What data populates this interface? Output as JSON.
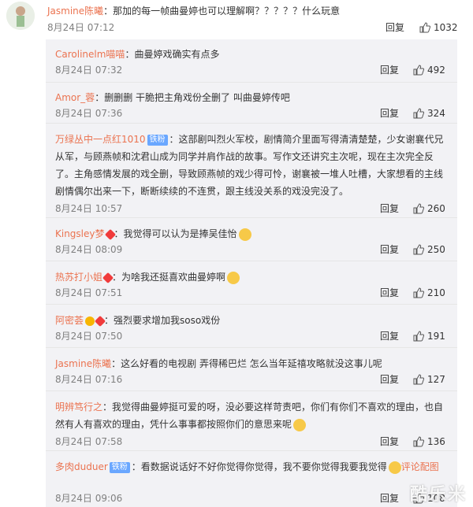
{
  "top": {
    "user": "Jasmine陈曦",
    "text": "：那加的每一帧曲曼婷也可以理解啊？？？？？什么玩意",
    "date": "8月24日 07:12",
    "reply": "回复",
    "likes": "1032"
  },
  "thread": [
    {
      "user": "Carolinelm喵喵",
      "text": "：曲曼婷戏确实有点多",
      "date": "8月24日 07:32",
      "reply": "回复",
      "likes": "492"
    },
    {
      "user": "Amor_蓉",
      "text": "：删删删 干脆把主角戏份全删了 叫曲曼婷传吧",
      "date": "8月24日 07:36",
      "reply": "回复",
      "likes": "324"
    },
    {
      "user": "万绿丛中一点红1010",
      "badge": "铁粉",
      "text": "：这部剧叫烈火军校，剧情简介里面写得清清楚楚，少女谢襄代兄从军，与顾燕帧和沈君山成为同学并肩作战的故事。写作文还讲究主次呢，现在主次完全反了。主角感情发展的戏全删，导致顾燕帧的戏少得可怜，谢襄被一堆人吐槽，大家想看的主线剧情偶尔出来一下，断断续续的不连贯，跟主线没关系的戏没完没了。",
      "date": "8月24日 10:57",
      "reply": "回复",
      "likes": "260"
    },
    {
      "user": "Kingsley梦",
      "text": "：我觉得可以认为是捧吴佳怡",
      "date": "8月24日 08:09",
      "reply": "回复",
      "likes": "250"
    },
    {
      "user": "热苏打小姐",
      "text": "：为啥我还挺喜欢曲曼婷啊",
      "date": "8月24日 07:51",
      "reply": "回复",
      "likes": "210"
    },
    {
      "user": "阿密荟",
      "text": "：强烈要求增加我soso戏份",
      "date": "8月24日 07:50",
      "reply": "回复",
      "likes": "191"
    },
    {
      "user": "Jasmine陈曦",
      "text": "：这么好看的电视剧 弄得稀巴烂 怎么当年延禧攻略就没这事儿呢",
      "date": "8月24日 07:16",
      "reply": "回复",
      "likes": "127"
    },
    {
      "user": "明辨笃行之",
      "text": "：我觉得曲曼婷挺可爱的呀，没必要这样苛责吧，你们有你们不喜欢的理由，也自然有人有喜欢的理由，凭什么事事都按照你们的意思来呢",
      "date": "8月24日 07:58",
      "reply": "回复",
      "likes": "136"
    },
    {
      "user": "多肉duduer",
      "badge": "铁粉",
      "text": "：看数据说话好不好你觉得你觉得，我不要你觉得我要我觉得",
      "link": "评论配图",
      "date": "8月24日 09:06",
      "reply": "回复",
      "likes": "108"
    }
  ],
  "watermark": "酷乐米",
  "colors": {
    "username": "#eb7350",
    "thread_bg": "#f2f2f5",
    "badge": "#6aa7ff"
  }
}
